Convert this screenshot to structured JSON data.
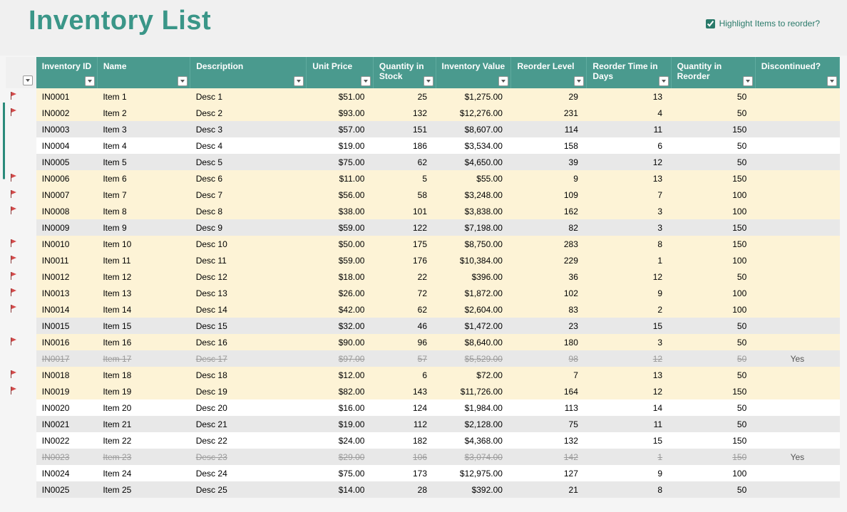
{
  "title": "Inventory List",
  "highlight_checkbox": {
    "label": "Highlight Items to reorder?",
    "checked": true
  },
  "columns": [
    {
      "key": "id",
      "label": "Inventory ID"
    },
    {
      "key": "name",
      "label": "Name"
    },
    {
      "key": "desc",
      "label": "Description"
    },
    {
      "key": "price",
      "label": "Unit Price"
    },
    {
      "key": "stock",
      "label": "Quantity in Stock"
    },
    {
      "key": "value",
      "label": "Inventory Value"
    },
    {
      "key": "reorder",
      "label": "Reorder Level"
    },
    {
      "key": "rtime",
      "label": "Reorder Time in Days"
    },
    {
      "key": "qreor",
      "label": "Quantity in Reorder"
    },
    {
      "key": "disc",
      "label": "Discontinued?"
    }
  ],
  "rows": [
    {
      "flag": true,
      "id": "IN0001",
      "name": "Item 1",
      "desc": "Desc 1",
      "price": "$51.00",
      "stock": "25",
      "value": "$1,275.00",
      "reorder": "29",
      "rtime": "13",
      "qreor": "50",
      "disc": "",
      "discontinued": false,
      "highlight": true
    },
    {
      "flag": true,
      "id": "IN0002",
      "name": "Item 2",
      "desc": "Desc 2",
      "price": "$93.00",
      "stock": "132",
      "value": "$12,276.00",
      "reorder": "231",
      "rtime": "4",
      "qreor": "50",
      "disc": "",
      "discontinued": false,
      "highlight": true
    },
    {
      "flag": false,
      "id": "IN0003",
      "name": "Item 3",
      "desc": "Desc 3",
      "price": "$57.00",
      "stock": "151",
      "value": "$8,607.00",
      "reorder": "114",
      "rtime": "11",
      "qreor": "150",
      "disc": "",
      "discontinued": false,
      "highlight": false
    },
    {
      "flag": false,
      "id": "IN0004",
      "name": "Item 4",
      "desc": "Desc 4",
      "price": "$19.00",
      "stock": "186",
      "value": "$3,534.00",
      "reorder": "158",
      "rtime": "6",
      "qreor": "50",
      "disc": "",
      "discontinued": false,
      "highlight": false
    },
    {
      "flag": false,
      "id": "IN0005",
      "name": "Item 5",
      "desc": "Desc 5",
      "price": "$75.00",
      "stock": "62",
      "value": "$4,650.00",
      "reorder": "39",
      "rtime": "12",
      "qreor": "50",
      "disc": "",
      "discontinued": false,
      "highlight": false
    },
    {
      "flag": true,
      "id": "IN0006",
      "name": "Item 6",
      "desc": "Desc 6",
      "price": "$11.00",
      "stock": "5",
      "value": "$55.00",
      "reorder": "9",
      "rtime": "13",
      "qreor": "150",
      "disc": "",
      "discontinued": false,
      "highlight": true
    },
    {
      "flag": true,
      "id": "IN0007",
      "name": "Item 7",
      "desc": "Desc 7",
      "price": "$56.00",
      "stock": "58",
      "value": "$3,248.00",
      "reorder": "109",
      "rtime": "7",
      "qreor": "100",
      "disc": "",
      "discontinued": false,
      "highlight": true
    },
    {
      "flag": true,
      "id": "IN0008",
      "name": "Item 8",
      "desc": "Desc 8",
      "price": "$38.00",
      "stock": "101",
      "value": "$3,838.00",
      "reorder": "162",
      "rtime": "3",
      "qreor": "100",
      "disc": "",
      "discontinued": false,
      "highlight": true
    },
    {
      "flag": false,
      "id": "IN0009",
      "name": "Item 9",
      "desc": "Desc 9",
      "price": "$59.00",
      "stock": "122",
      "value": "$7,198.00",
      "reorder": "82",
      "rtime": "3",
      "qreor": "150",
      "disc": "",
      "discontinued": false,
      "highlight": false
    },
    {
      "flag": true,
      "id": "IN0010",
      "name": "Item 10",
      "desc": "Desc 10",
      "price": "$50.00",
      "stock": "175",
      "value": "$8,750.00",
      "reorder": "283",
      "rtime": "8",
      "qreor": "150",
      "disc": "",
      "discontinued": false,
      "highlight": true
    },
    {
      "flag": true,
      "id": "IN0011",
      "name": "Item 11",
      "desc": "Desc 11",
      "price": "$59.00",
      "stock": "176",
      "value": "$10,384.00",
      "reorder": "229",
      "rtime": "1",
      "qreor": "100",
      "disc": "",
      "discontinued": false,
      "highlight": true
    },
    {
      "flag": true,
      "id": "IN0012",
      "name": "Item 12",
      "desc": "Desc 12",
      "price": "$18.00",
      "stock": "22",
      "value": "$396.00",
      "reorder": "36",
      "rtime": "12",
      "qreor": "50",
      "disc": "",
      "discontinued": false,
      "highlight": true
    },
    {
      "flag": true,
      "id": "IN0013",
      "name": "Item 13",
      "desc": "Desc 13",
      "price": "$26.00",
      "stock": "72",
      "value": "$1,872.00",
      "reorder": "102",
      "rtime": "9",
      "qreor": "100",
      "disc": "",
      "discontinued": false,
      "highlight": true
    },
    {
      "flag": true,
      "id": "IN0014",
      "name": "Item 14",
      "desc": "Desc 14",
      "price": "$42.00",
      "stock": "62",
      "value": "$2,604.00",
      "reorder": "83",
      "rtime": "2",
      "qreor": "100",
      "disc": "",
      "discontinued": false,
      "highlight": true
    },
    {
      "flag": false,
      "id": "IN0015",
      "name": "Item 15",
      "desc": "Desc 15",
      "price": "$32.00",
      "stock": "46",
      "value": "$1,472.00",
      "reorder": "23",
      "rtime": "15",
      "qreor": "50",
      "disc": "",
      "discontinued": false,
      "highlight": false
    },
    {
      "flag": true,
      "id": "IN0016",
      "name": "Item 16",
      "desc": "Desc 16",
      "price": "$90.00",
      "stock": "96",
      "value": "$8,640.00",
      "reorder": "180",
      "rtime": "3",
      "qreor": "50",
      "disc": "",
      "discontinued": false,
      "highlight": true
    },
    {
      "flag": false,
      "id": "IN0017",
      "name": "Item 17",
      "desc": "Desc 17",
      "price": "$97.00",
      "stock": "57",
      "value": "$5,529.00",
      "reorder": "98",
      "rtime": "12",
      "qreor": "50",
      "disc": "Yes",
      "discontinued": true,
      "highlight": false
    },
    {
      "flag": true,
      "id": "IN0018",
      "name": "Item 18",
      "desc": "Desc 18",
      "price": "$12.00",
      "stock": "6",
      "value": "$72.00",
      "reorder": "7",
      "rtime": "13",
      "qreor": "50",
      "disc": "",
      "discontinued": false,
      "highlight": true
    },
    {
      "flag": true,
      "id": "IN0019",
      "name": "Item 19",
      "desc": "Desc 19",
      "price": "$82.00",
      "stock": "143",
      "value": "$11,726.00",
      "reorder": "164",
      "rtime": "12",
      "qreor": "150",
      "disc": "",
      "discontinued": false,
      "highlight": true
    },
    {
      "flag": false,
      "id": "IN0020",
      "name": "Item 20",
      "desc": "Desc 20",
      "price": "$16.00",
      "stock": "124",
      "value": "$1,984.00",
      "reorder": "113",
      "rtime": "14",
      "qreor": "50",
      "disc": "",
      "discontinued": false,
      "highlight": false
    },
    {
      "flag": false,
      "id": "IN0021",
      "name": "Item 21",
      "desc": "Desc 21",
      "price": "$19.00",
      "stock": "112",
      "value": "$2,128.00",
      "reorder": "75",
      "rtime": "11",
      "qreor": "50",
      "disc": "",
      "discontinued": false,
      "highlight": false
    },
    {
      "flag": false,
      "id": "IN0022",
      "name": "Item 22",
      "desc": "Desc 22",
      "price": "$24.00",
      "stock": "182",
      "value": "$4,368.00",
      "reorder": "132",
      "rtime": "15",
      "qreor": "150",
      "disc": "",
      "discontinued": false,
      "highlight": false
    },
    {
      "flag": false,
      "id": "IN0023",
      "name": "Item 23",
      "desc": "Desc 23",
      "price": "$29.00",
      "stock": "106",
      "value": "$3,074.00",
      "reorder": "142",
      "rtime": "1",
      "qreor": "150",
      "disc": "Yes",
      "discontinued": true,
      "highlight": false
    },
    {
      "flag": false,
      "id": "IN0024",
      "name": "Item 24",
      "desc": "Desc 24",
      "price": "$75.00",
      "stock": "173",
      "value": "$12,975.00",
      "reorder": "127",
      "rtime": "9",
      "qreor": "100",
      "disc": "",
      "discontinued": false,
      "highlight": false
    },
    {
      "flag": false,
      "id": "IN0025",
      "name": "Item 25",
      "desc": "Desc 25",
      "price": "$14.00",
      "stock": "28",
      "value": "$392.00",
      "reorder": "21",
      "rtime": "8",
      "qreor": "50",
      "disc": "",
      "discontinued": false,
      "highlight": false
    }
  ]
}
